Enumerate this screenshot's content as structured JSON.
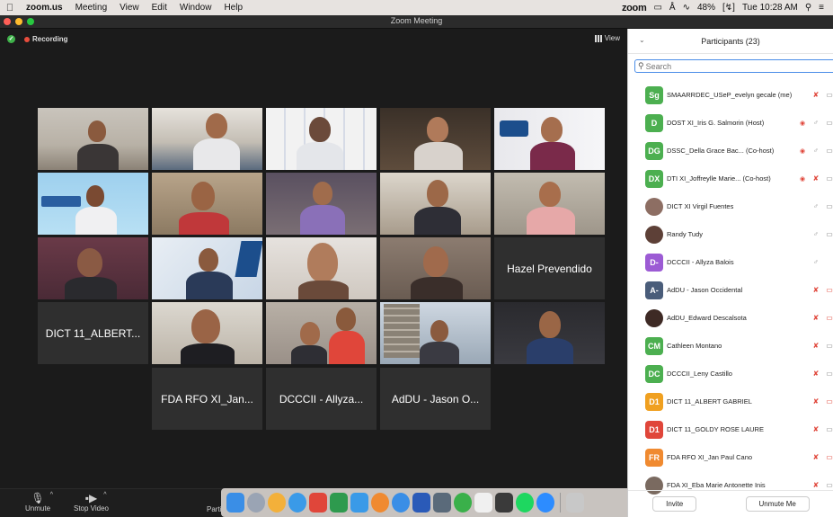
{
  "menubar": {
    "app": "zoom.us",
    "items": [
      "Meeting",
      "View",
      "Edit",
      "Window",
      "Help"
    ],
    "zoom_word": "zoom",
    "battery": "48%",
    "clock": "Tue 10:28 AM"
  },
  "window": {
    "title": "Zoom Meeting"
  },
  "stage": {
    "recording_label": "Recording",
    "view_label": "View"
  },
  "tiles": {
    "r3c5": "Hazel Prevendido",
    "r4c1": "DICT 11_ALBERT...",
    "r5c2": "FDA RFO XI_Jan...",
    "r5c3": "DCCCII - Allyza...",
    "r5c4": "AdDU - Jason O..."
  },
  "controls": {
    "unmute": "Unmute",
    "stop_video": "Stop Video",
    "participants_partial": "Parti"
  },
  "panel": {
    "title": "Participants (23)",
    "search_placeholder": "Search",
    "invite": "Invite",
    "unmute_me": "Unmute Me",
    "participants": [
      {
        "initials": "Sg",
        "color": "#4caf50",
        "name": "SMAARRDEC_USeP_evelyn gecale  (me)",
        "mic": "off",
        "cam": "on"
      },
      {
        "initials": "D",
        "color": "#4caf50",
        "name": "DOST XI_Iris G. Salmorin (Host)",
        "mic": "on",
        "cam": "on",
        "hand": true
      },
      {
        "initials": "DG",
        "color": "#4caf50",
        "name": "DSSC_Della Grace Bac...  (Co-host)",
        "mic": "on",
        "cam": "on",
        "hand": true
      },
      {
        "initials": "DX",
        "color": "#4caf50",
        "name": "DTI XI_Joffreylle Marie...  (Co-host)",
        "mic": "off",
        "cam": "on",
        "hand": true
      },
      {
        "initials": "",
        "color": "#8d6e63",
        "photo": true,
        "name": "DICT XI Virgil Fuentes",
        "mic": "on",
        "cam": "on"
      },
      {
        "initials": "",
        "color": "#5d4037",
        "photo": true,
        "name": "Randy Tudy",
        "mic": "on",
        "cam": "on"
      },
      {
        "initials": "D-",
        "color": "#9c5bd4",
        "name": "DCCCII - Allyza Balois",
        "mic": "on",
        "cam": ""
      },
      {
        "initials": "A-",
        "color": "#4a5d7a",
        "name": "AdDU - Jason Occidental",
        "mic": "off",
        "cam": "off"
      },
      {
        "initials": "",
        "color": "#3e2a25",
        "photo": true,
        "name": "AdDU_Edward Descalsota",
        "mic": "off",
        "cam": "off"
      },
      {
        "initials": "CM",
        "color": "#4caf50",
        "name": "Cathleen Montano",
        "mic": "off",
        "cam": "on"
      },
      {
        "initials": "DC",
        "color": "#4caf50",
        "name": "DCCCII_Leny Castillo",
        "mic": "off",
        "cam": "on"
      },
      {
        "initials": "D1",
        "color": "#f0a020",
        "name": "DICT 11_ALBERT GABRIEL",
        "mic": "off",
        "cam": "off"
      },
      {
        "initials": "D1",
        "color": "#e0463a",
        "name": "DICT 11_GOLDY ROSE LAURE",
        "mic": "off",
        "cam": "on"
      },
      {
        "initials": "FR",
        "color": "#f08a30",
        "name": "FDA RFO XI_Jan Paul Cano",
        "mic": "off",
        "cam": "off"
      },
      {
        "initials": "",
        "color": "#7a6a60",
        "photo": true,
        "name": "FDA XI_Eba Marie Antonette Inis",
        "mic": "off",
        "cam": "on"
      }
    ]
  },
  "colors": {
    "active_speaker": "#6acf4b",
    "recording_dot": "#e84d3d",
    "muted_red": "#e0463a",
    "search_focus": "#4a8de8"
  }
}
